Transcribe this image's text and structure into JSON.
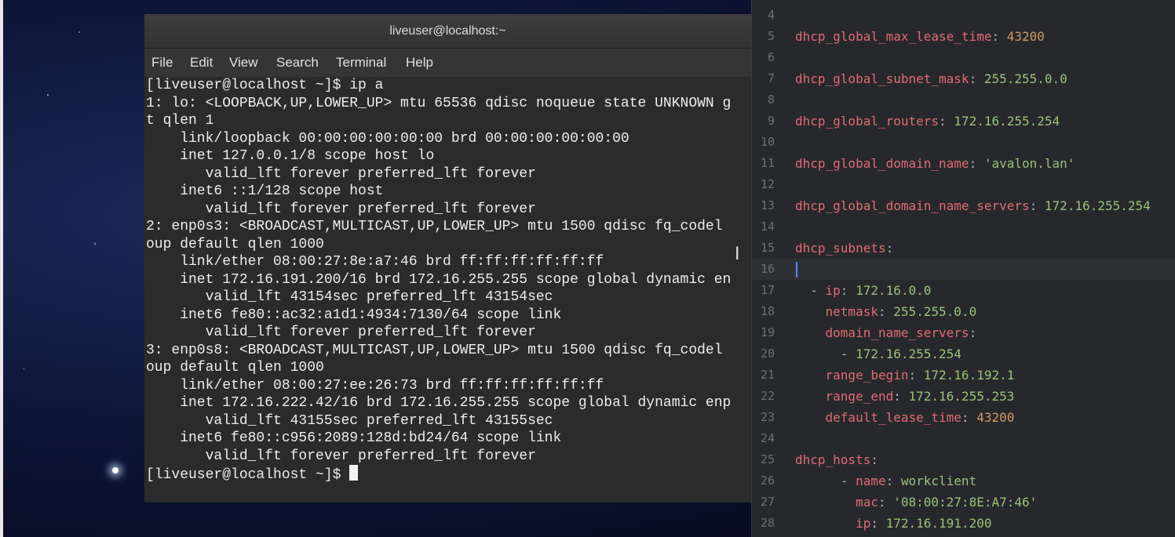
{
  "terminal": {
    "title": "liveuser@localhost:~",
    "menu": [
      "File",
      "Edit",
      "View",
      "Search",
      "Terminal",
      "Help"
    ],
    "lines": [
      "[liveuser@localhost ~]$ ip a",
      "1: lo: <LOOPBACK,UP,LOWER_UP> mtu 65536 qdisc noqueue state UNKNOWN g",
      "t qlen 1",
      "    link/loopback 00:00:00:00:00:00 brd 00:00:00:00:00:00",
      "    inet 127.0.0.1/8 scope host lo",
      "       valid_lft forever preferred_lft forever",
      "    inet6 ::1/128 scope host",
      "       valid_lft forever preferred_lft forever",
      "2: enp0s3: <BROADCAST,MULTICAST,UP,LOWER_UP> mtu 1500 qdisc fq_codel",
      "oup default qlen 1000",
      "    link/ether 08:00:27:8e:a7:46 brd ff:ff:ff:ff:ff:ff",
      "    inet 172.16.191.200/16 brd 172.16.255.255 scope global dynamic en",
      "       valid_lft 43154sec preferred_lft 43154sec",
      "    inet6 fe80::ac32:a1d1:4934:7130/64 scope link",
      "       valid_lft forever preferred_lft forever",
      "3: enp0s8: <BROADCAST,MULTICAST,UP,LOWER_UP> mtu 1500 qdisc fq_codel",
      "oup default qlen 1000",
      "    link/ether 08:00:27:ee:26:73 brd ff:ff:ff:ff:ff:ff",
      "    inet 172.16.222.42/16 brd 172.16.255.255 scope global dynamic enp",
      "       valid_lft 43155sec preferred_lft 43155sec",
      "    inet6 fe80::c956:2089:128d:bd24/64 scope link",
      "       valid_lft forever preferred_lft forever"
    ],
    "prompt": "[liveuser@localhost ~]$ "
  },
  "editor": {
    "lines": [
      {
        "n": "4",
        "indent": "",
        "key": "",
        "sep": "",
        "val": "",
        "vtype": ""
      },
      {
        "n": "5",
        "indent": "",
        "key": "dhcp_global_max_lease_time",
        "sep": ": ",
        "val": "43200",
        "vtype": "n"
      },
      {
        "n": "6",
        "indent": "",
        "key": "",
        "sep": "",
        "val": "",
        "vtype": ""
      },
      {
        "n": "7",
        "indent": "",
        "key": "dhcp_global_subnet_mask",
        "sep": ": ",
        "val": "255.255.0.0",
        "vtype": "v"
      },
      {
        "n": "8",
        "indent": "",
        "key": "",
        "sep": "",
        "val": "",
        "vtype": ""
      },
      {
        "n": "9",
        "indent": "",
        "key": "dhcp_global_routers",
        "sep": ": ",
        "val": "172.16.255.254",
        "vtype": "v"
      },
      {
        "n": "10",
        "indent": "",
        "key": "",
        "sep": "",
        "val": "",
        "vtype": ""
      },
      {
        "n": "11",
        "indent": "",
        "key": "dhcp_global_domain_name",
        "sep": ": ",
        "val": "'avalon.lan'",
        "vtype": "v"
      },
      {
        "n": "12",
        "indent": "",
        "key": "",
        "sep": "",
        "val": "",
        "vtype": ""
      },
      {
        "n": "13",
        "indent": "",
        "key": "dhcp_global_domain_name_servers",
        "sep": ": ",
        "val": "172.16.255.254",
        "vtype": "v"
      },
      {
        "n": "14",
        "indent": "",
        "key": "",
        "sep": "",
        "val": "",
        "vtype": ""
      },
      {
        "n": "15",
        "indent": "",
        "key": "dhcp_subnets",
        "sep": ":",
        "val": "",
        "vtype": ""
      },
      {
        "n": "16",
        "indent": "",
        "key": "",
        "sep": "",
        "val": "",
        "vtype": ""
      },
      {
        "n": "17",
        "indent": "  - ",
        "key": "ip",
        "sep": ": ",
        "val": "172.16.0.0",
        "vtype": "v"
      },
      {
        "n": "18",
        "indent": "    ",
        "key": "netmask",
        "sep": ": ",
        "val": "255.255.0.0",
        "vtype": "v"
      },
      {
        "n": "19",
        "indent": "    ",
        "key": "domain_name_servers",
        "sep": ":",
        "val": "",
        "vtype": ""
      },
      {
        "n": "20",
        "indent": "      - ",
        "key": "",
        "sep": "",
        "val": "172.16.255.254",
        "vtype": "v"
      },
      {
        "n": "21",
        "indent": "    ",
        "key": "range_begin",
        "sep": ": ",
        "val": "172.16.192.1",
        "vtype": "v"
      },
      {
        "n": "22",
        "indent": "    ",
        "key": "range_end",
        "sep": ": ",
        "val": "172.16.255.253",
        "vtype": "v"
      },
      {
        "n": "23",
        "indent": "    ",
        "key": "default_lease_time",
        "sep": ": ",
        "val": "43200",
        "vtype": "n"
      },
      {
        "n": "24",
        "indent": "",
        "key": "",
        "sep": "",
        "val": "",
        "vtype": ""
      },
      {
        "n": "25",
        "indent": "",
        "key": "dhcp_hosts",
        "sep": ":",
        "val": "",
        "vtype": ""
      },
      {
        "n": "26",
        "indent": "      - ",
        "key": "name",
        "sep": ": ",
        "val": "workclient",
        "vtype": "v"
      },
      {
        "n": "27",
        "indent": "        ",
        "key": "mac",
        "sep": ": ",
        "val": "'08:00:27:8E:A7:46'",
        "vtype": "v"
      },
      {
        "n": "28",
        "indent": "        ",
        "key": "ip",
        "sep": ": ",
        "val": "172.16.191.200",
        "vtype": "v"
      }
    ]
  },
  "colors": {
    "key": "#e06c75",
    "string": "#98c379",
    "number": "#d19a66"
  }
}
